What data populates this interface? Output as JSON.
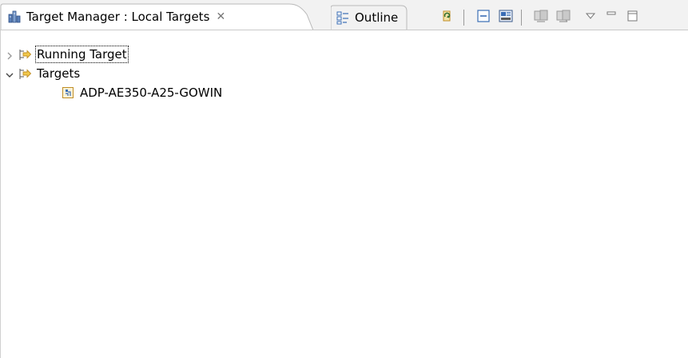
{
  "tabs": {
    "active_label": "Target Manager : Local Targets",
    "close_glyph": "✕",
    "outline_label": "Outline"
  },
  "toolbar": {
    "icons": [
      "refresh-icon",
      "collapse-all-icon",
      "filter-icon",
      "sync-icon",
      "sync-all-icon",
      "view-menu-icon",
      "minimize-icon",
      "maximize-icon"
    ]
  },
  "tree": {
    "running_target": "Running Target",
    "targets": "Targets",
    "target_item": "ADP-AE350-A25-GOWIN"
  },
  "colors": {
    "background": "#ffffff",
    "tabbar": "#f2f2f2",
    "accent": "#d9a230"
  }
}
